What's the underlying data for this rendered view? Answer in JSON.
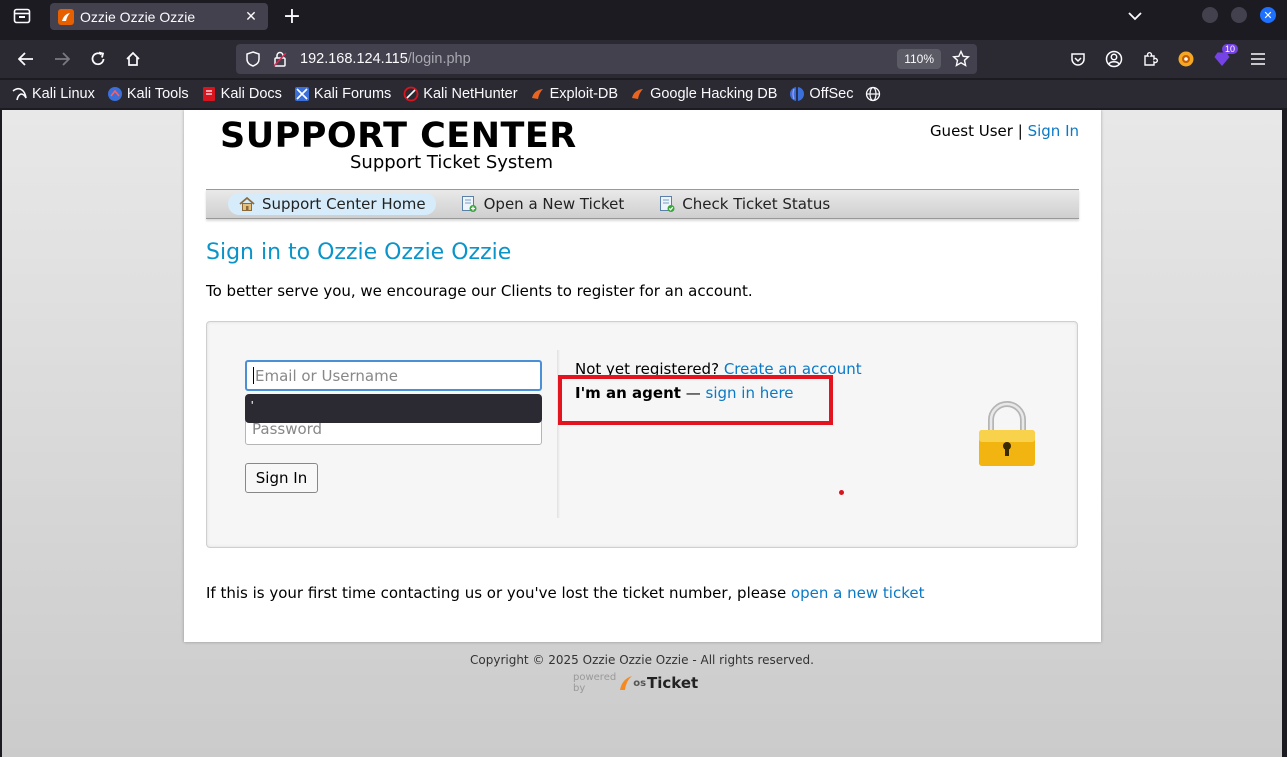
{
  "browser": {
    "tab_title": "Ozzie Ozzie Ozzie",
    "url_host": "192.168.124.115",
    "url_path": "/login.php",
    "zoom": "110%",
    "extension_badge": "10",
    "bookmarks": [
      {
        "label": "Kali Linux",
        "icon": "kali-dragon-icon"
      },
      {
        "label": "Kali Tools",
        "icon": "kali-tools-icon"
      },
      {
        "label": "Kali Docs",
        "icon": "kali-docs-icon"
      },
      {
        "label": "Kali Forums",
        "icon": "kali-forums-icon"
      },
      {
        "label": "Kali NetHunter",
        "icon": "nethunter-icon"
      },
      {
        "label": "Exploit-DB",
        "icon": "exploitdb-icon"
      },
      {
        "label": "Google Hacking DB",
        "icon": "ghdb-icon"
      },
      {
        "label": "OffSec",
        "icon": "offsec-icon"
      }
    ]
  },
  "header": {
    "logo_main": "SUPPORT CENTER",
    "logo_sub": "Support Ticket System",
    "guest_label": "Guest User",
    "separator": "|",
    "sign_in": "Sign In"
  },
  "nav": {
    "items": [
      {
        "label": "Support Center Home",
        "icon": "home-icon"
      },
      {
        "label": "Open a New Ticket",
        "icon": "new-ticket-icon"
      },
      {
        "label": "Check Ticket Status",
        "icon": "ticket-status-icon"
      }
    ]
  },
  "main": {
    "title": "Sign in to Ozzie Ozzie Ozzie",
    "intro": "To better serve you, we encourage our Clients to register for an account.",
    "email_placeholder": "Email or Username",
    "password_placeholder": "Password",
    "autofill_text": "'",
    "signin_button": "Sign In",
    "not_registered": "Not yet registered?",
    "create_account": "Create an account",
    "agent_label": "I'm an agent",
    "agent_dash": "—",
    "agent_link": "sign in here",
    "first_time_text": "If this is your first time contacting us or you've lost the ticket number, please",
    "first_time_link": "open a new ticket"
  },
  "footer": {
    "copyright": "Copyright © 2025 Ozzie Ozzie Ozzie - All rights reserved.",
    "powered_by": "powered by",
    "powered_os": "os",
    "powered_brand": "Ticket"
  },
  "colors": {
    "link": "#0a79c6",
    "title": "#0a94c9",
    "highlight": "#e3141f"
  }
}
